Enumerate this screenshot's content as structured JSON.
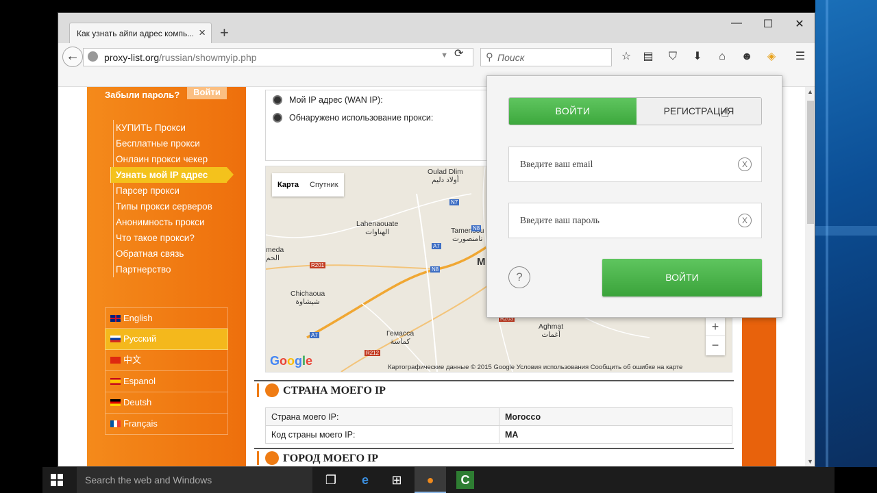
{
  "browser": {
    "tab_title": "Как узнать айпи адрес компь...",
    "url_domain": "proxy-list.org",
    "url_path": "/russian/showmyip.php",
    "search_placeholder": "Поиск"
  },
  "sidebar": {
    "forgot": "Забыли пароль?",
    "login_mini": "Войти",
    "menu": [
      "КУПИТЬ Прокси",
      "Бесплатные прокси",
      "Онлаин прокси чекер",
      "Узнать мой IP адрес",
      "Парсер прокси",
      "Типы прокси серверов",
      "Анонимность прокси",
      "Что такое прокси?",
      "Обратная связь",
      "Партнерство"
    ],
    "active_index": 3,
    "languages": [
      "English",
      "Русский",
      "中文",
      "Espanol",
      "Deutsh",
      "Français"
    ],
    "active_language_index": 1
  },
  "ipinfo": {
    "wan_label": "Мой IP адрес (WAN IP):",
    "proxy_label": "Обнаружено использование прокси:"
  },
  "map": {
    "type_map": "Карта",
    "type_satellite": "Спутник",
    "labels": {
      "oulad": "Oulad Dlim\nأولاد دليم",
      "lahena": "Lahenaouate\nالهناوات",
      "tamens": "Tamensou\nتامنصورت",
      "meda": "meda\nالحم",
      "chich": "Chichaoua\nشيشاوة",
      "gemassa": "Гемасса\nكماسة",
      "aghmat": "Aghmat\nأغمات",
      "m": "M"
    },
    "roads": [
      "N7",
      "A7",
      "N8",
      "R201",
      "N8",
      "A7",
      "R212",
      "R203"
    ],
    "google": "Google",
    "footer": "Картографические данные © 2015 Google   Условия использования   Сообщить об ошибке на карте",
    "zoom_in": "+",
    "zoom_out": "−"
  },
  "country": {
    "title": "СТРАНА МОЕГО IP",
    "rows": [
      {
        "label": "Страна моего IP:",
        "value": "Morocco"
      },
      {
        "label": "Код страны моего IP:",
        "value": "MA"
      }
    ]
  },
  "city": {
    "title": "ГОРОД МОЕГО IP"
  },
  "popup": {
    "tab_login": "ВОЙТИ",
    "tab_register": "РЕГИСТРАЦИЯ",
    "email_placeholder": "Введите ваш email",
    "password_placeholder": "Введите ваш пароль",
    "submit": "ВОЙТИ",
    "help": "?"
  },
  "taskbar": {
    "search_placeholder": "Search the web and Windows"
  },
  "colors": {
    "orange": "#ef7c14",
    "green": "#4cb84c",
    "yellow": "#f4c21c"
  }
}
